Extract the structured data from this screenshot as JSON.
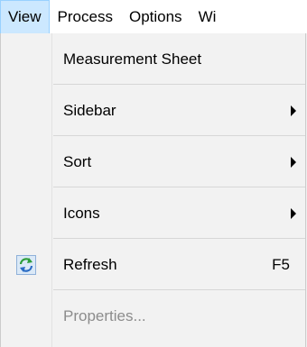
{
  "menubar": {
    "items": [
      {
        "label": "View",
        "active": true
      },
      {
        "label": "Process"
      },
      {
        "label": "Options"
      },
      {
        "label": "Wi"
      }
    ]
  },
  "view_menu": {
    "items": [
      {
        "label": "Measurement Sheet"
      },
      {
        "label": "Sidebar",
        "submenu": true
      },
      {
        "label": "Sort",
        "submenu": true
      },
      {
        "label": "Icons",
        "submenu": true
      },
      {
        "label": "Refresh",
        "shortcut": "F5",
        "icon": "refresh-icon"
      },
      {
        "label": "Properties...",
        "disabled": true
      }
    ]
  },
  "colors": {
    "active_menu_bg": "#cce8ff",
    "disabled_text": "#8c8c8c",
    "refresh_icon_green": "#2e9e3a",
    "refresh_icon_blue": "#2b6cc4"
  }
}
